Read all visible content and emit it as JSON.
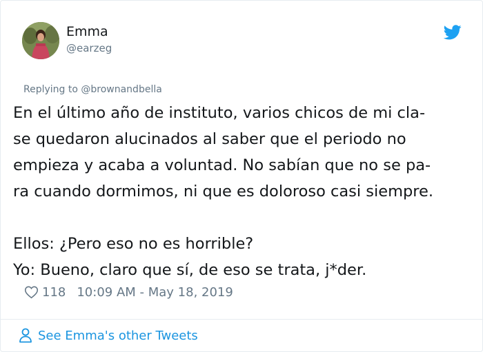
{
  "author": {
    "name": "Emma",
    "handle": "@earzeg"
  },
  "reply": {
    "text": "Replying to @brownandbella"
  },
  "tweet": {
    "lines": [
      "En el último año de instituto, varios chicos de mi cla-",
      "se quedaron alucinados al saber que el periodo no",
      "empieza y acaba a voluntad. No sabían que no se pa-",
      "ra cuando dormimos, ni que es doloroso casi siempre.",
      "Ellos: ¿Pero eso no es horrible?",
      "Yo: Bueno, claro que sí, de eso se trata, j*der."
    ]
  },
  "meta": {
    "likes": "118",
    "timestamp": "10:09 AM - May 18, 2019"
  },
  "footer": {
    "see_more": "See Emma's other Tweets"
  },
  "icons": {
    "brand": "twitter-bird-icon",
    "like": "heart-icon",
    "profile": "person-icon"
  },
  "colors": {
    "brand_blue": "#1da1f2",
    "link_blue": "#1b95e0",
    "text": "#14171a",
    "muted": "#657786",
    "border": "#e6ecf0"
  }
}
